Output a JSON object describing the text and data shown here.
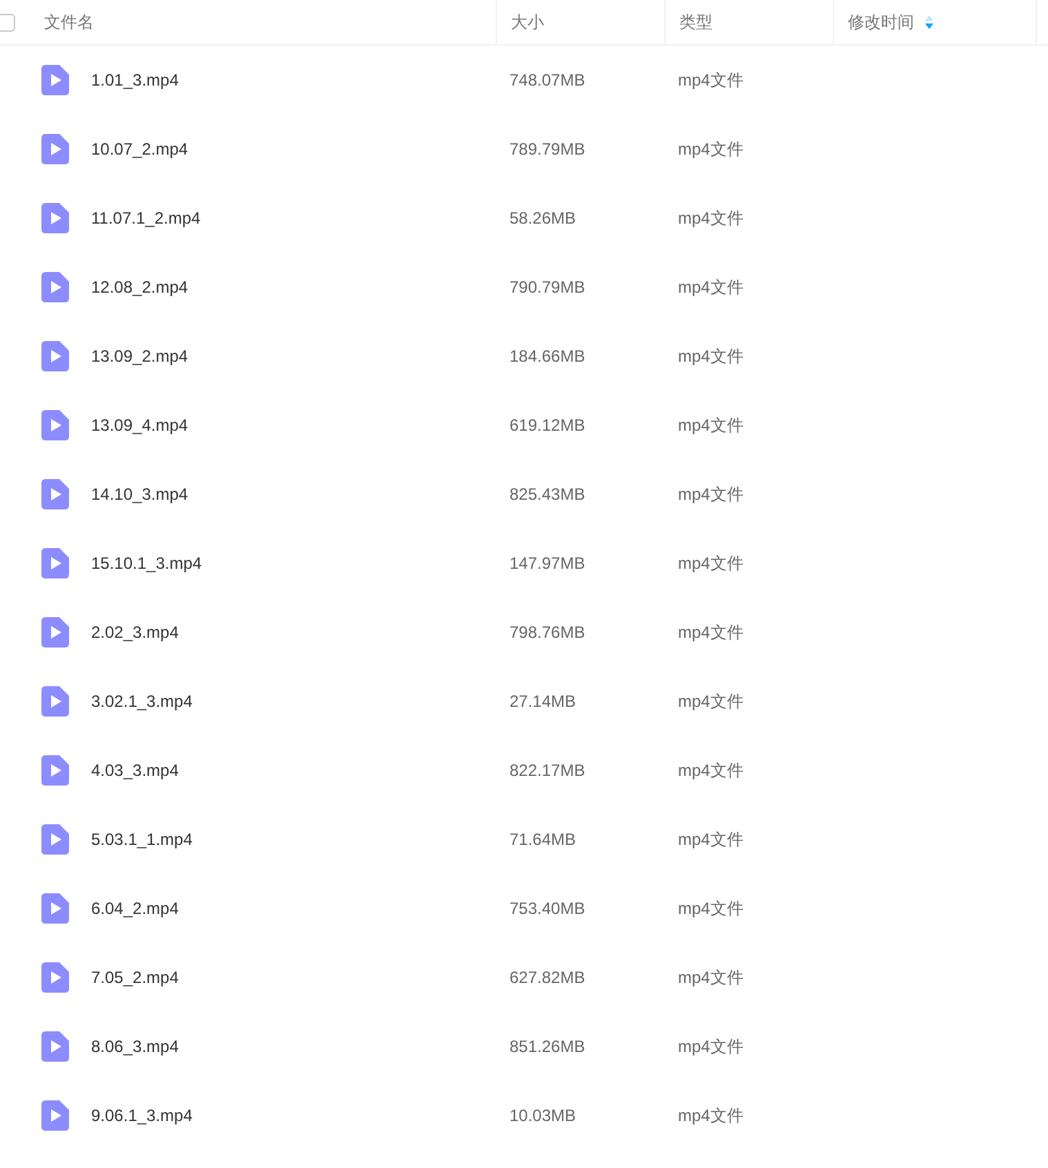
{
  "table": {
    "select_all": {
      "checked": false
    },
    "columns": [
      {
        "label": "文件名",
        "sorted": false
      },
      {
        "label": "大小",
        "sorted": false
      },
      {
        "label": "类型",
        "sorted": false
      },
      {
        "label": "修改时间",
        "sorted": true
      }
    ],
    "rows": [
      {
        "name": "1.01_3.mp4",
        "size": "748.07MB",
        "type": "mp4文件"
      },
      {
        "name": "10.07_2.mp4",
        "size": "789.79MB",
        "type": "mp4文件"
      },
      {
        "name": "11.07.1_2.mp4",
        "size": "58.26MB",
        "type": "mp4文件"
      },
      {
        "name": "12.08_2.mp4",
        "size": "790.79MB",
        "type": "mp4文件"
      },
      {
        "name": "13.09_2.mp4",
        "size": "184.66MB",
        "type": "mp4文件"
      },
      {
        "name": "13.09_4.mp4",
        "size": "619.12MB",
        "type": "mp4文件"
      },
      {
        "name": "14.10_3.mp4",
        "size": "825.43MB",
        "type": "mp4文件"
      },
      {
        "name": "15.10.1_3.mp4",
        "size": "147.97MB",
        "type": "mp4文件"
      },
      {
        "name": "2.02_3.mp4",
        "size": "798.76MB",
        "type": "mp4文件"
      },
      {
        "name": "3.02.1_3.mp4",
        "size": "27.14MB",
        "type": "mp4文件"
      },
      {
        "name": "4.03_3.mp4",
        "size": "822.17MB",
        "type": "mp4文件"
      },
      {
        "name": "5.03.1_1.mp4",
        "size": "71.64MB",
        "type": "mp4文件"
      },
      {
        "name": "6.04_2.mp4",
        "size": "753.40MB",
        "type": "mp4文件"
      },
      {
        "name": "7.05_2.mp4",
        "size": "627.82MB",
        "type": "mp4文件"
      },
      {
        "name": "8.06_3.mp4",
        "size": "851.26MB",
        "type": "mp4文件"
      },
      {
        "name": "9.06.1_3.mp4",
        "size": "10.03MB",
        "type": "mp4文件"
      }
    ]
  }
}
